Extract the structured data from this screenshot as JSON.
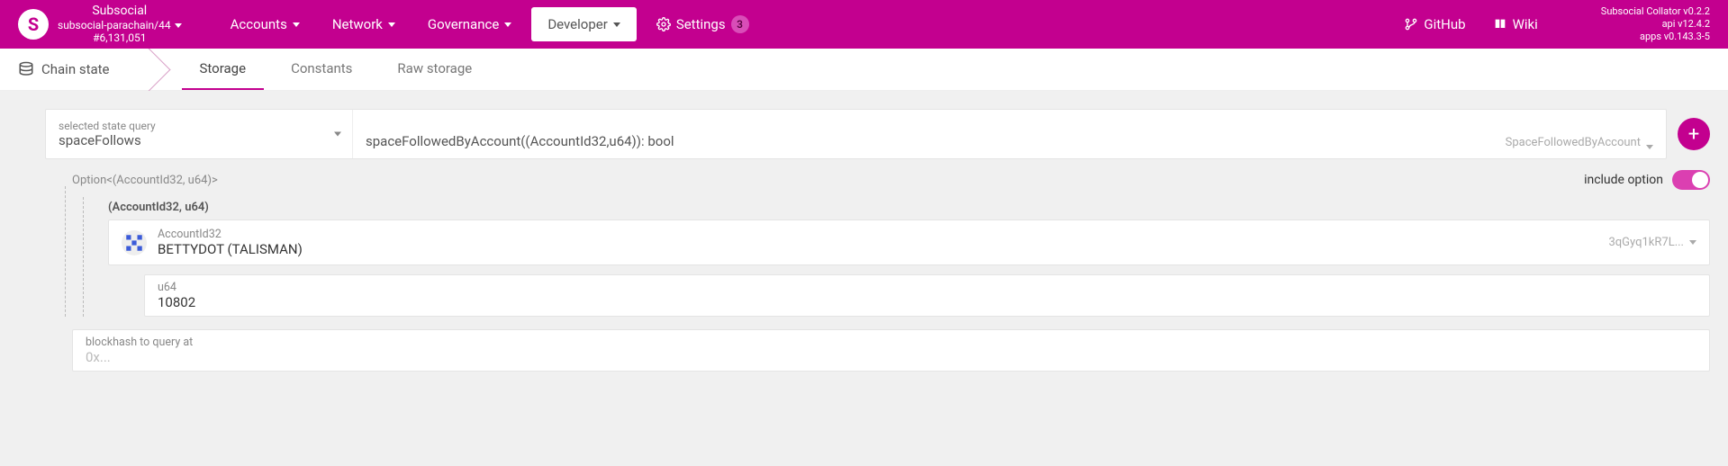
{
  "chain": {
    "name": "Subsocial",
    "parachain": "subsocial-parachain/44",
    "block": "#6,131,051"
  },
  "nav": {
    "accounts": "Accounts",
    "network": "Network",
    "governance": "Governance",
    "developer": "Developer",
    "settings": "Settings",
    "settings_badge": "3"
  },
  "top_links": {
    "github": "GitHub",
    "wiki": "Wiki"
  },
  "versions": {
    "collator": "Subsocial Collator v0.2.2",
    "api": "api v12.4.2",
    "apps": "apps v0.143.3-5"
  },
  "subtabs": {
    "root": "Chain state",
    "storage": "Storage",
    "constants": "Constants",
    "raw_storage": "Raw storage"
  },
  "query": {
    "label": "selected state query",
    "module": "spaceFollows",
    "method_signature": "spaceFollowedByAccount((AccountId32,u64)): bool",
    "return_type": "SpaceFollowedByAccount"
  },
  "option": {
    "type_label": "Option<(AccountId32, u64)>",
    "tuple_label": "(AccountId32, u64)",
    "include_label": "include option",
    "account": {
      "type": "AccountId32",
      "name": "BETTYDOT (TALISMAN)",
      "short_address": "3qGyq1kR7L..."
    },
    "u64": {
      "type": "u64",
      "value": "10802"
    }
  },
  "blockhash": {
    "label": "blockhash to query at",
    "placeholder": "0x..."
  }
}
